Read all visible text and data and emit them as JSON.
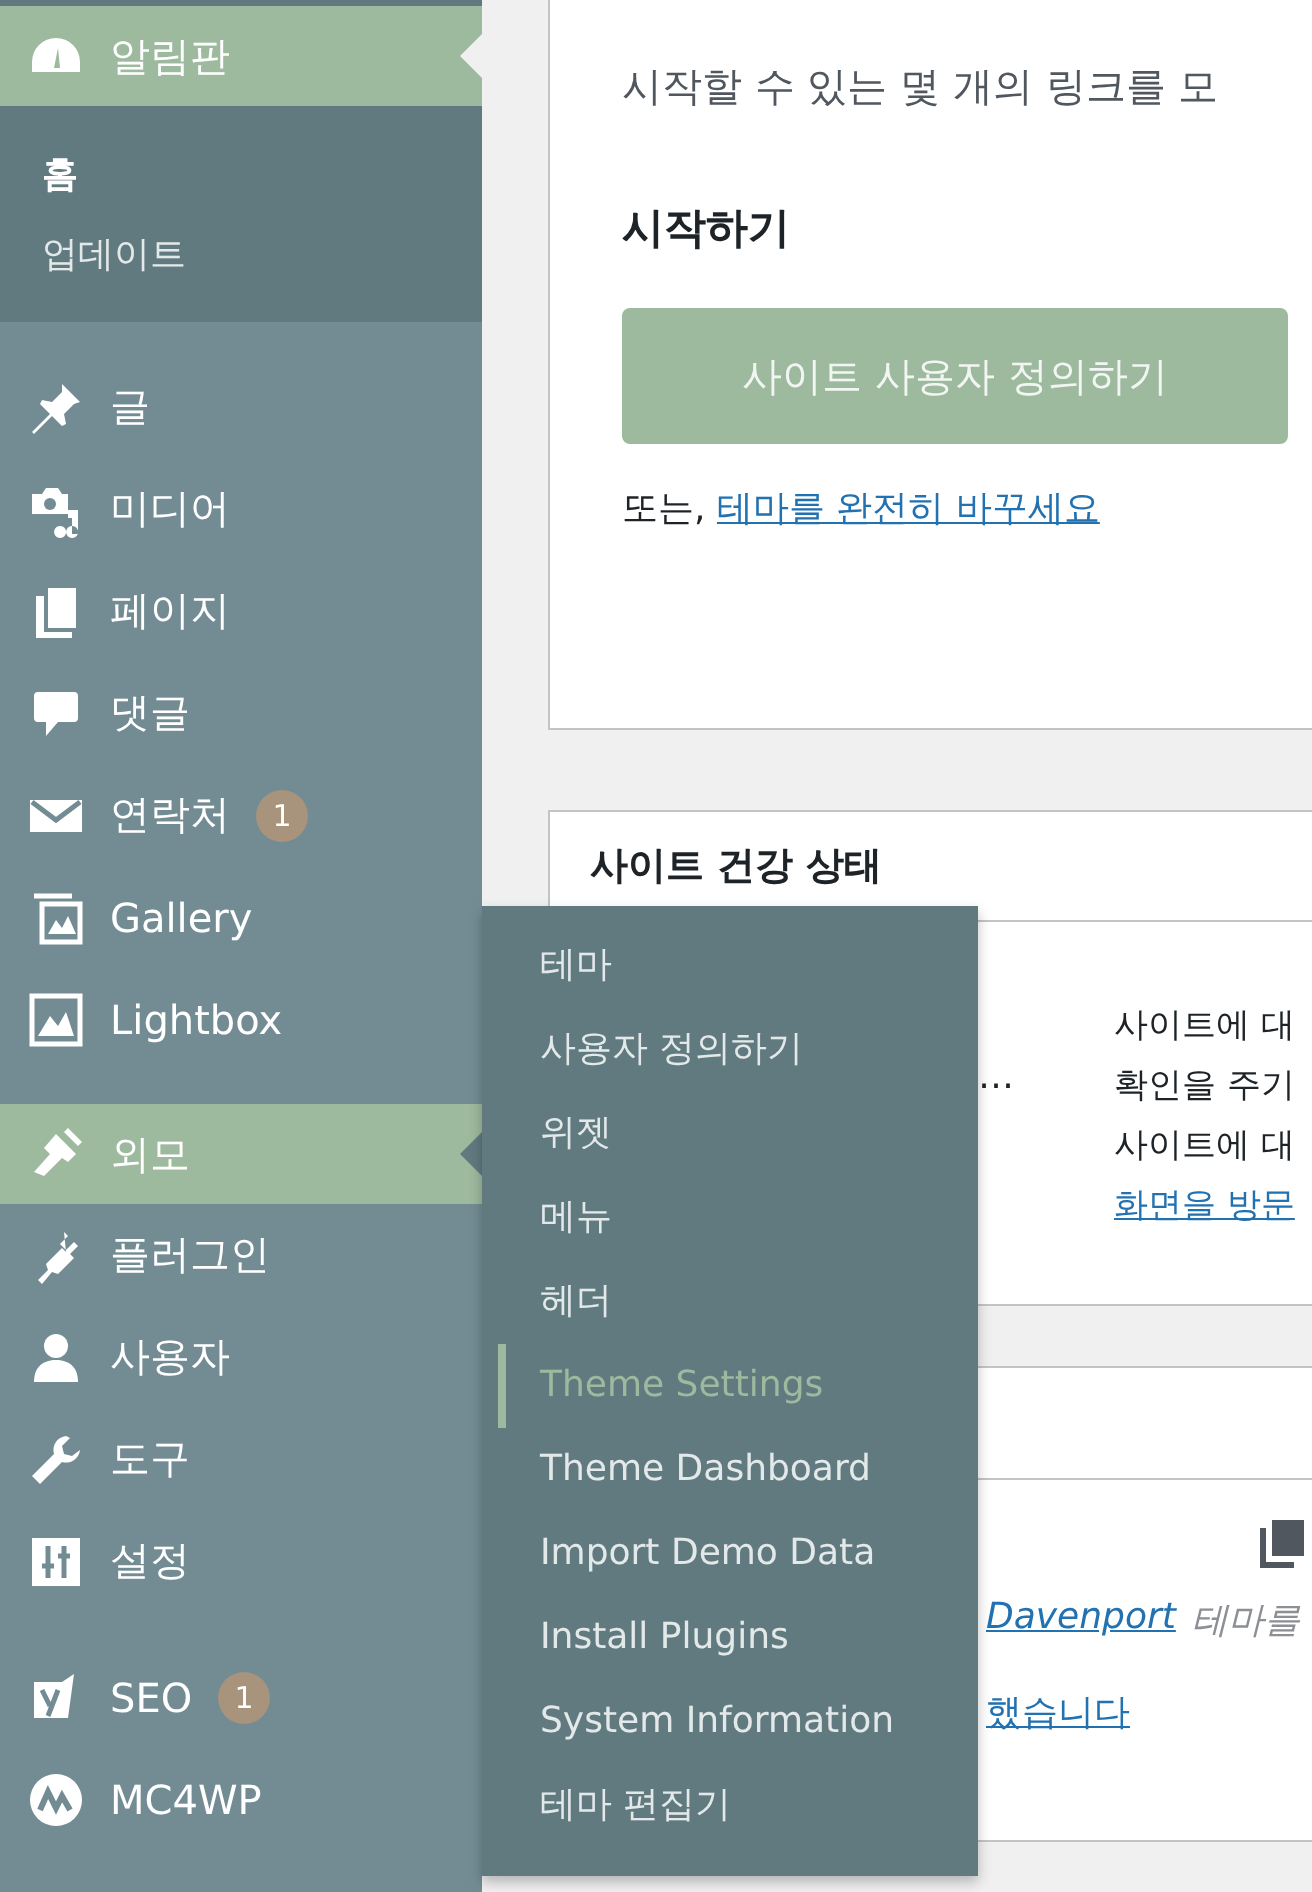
{
  "sidebar": {
    "groups": [
      [
        {
          "label": "알림판",
          "highlighted": true,
          "children": [
            {
              "label": "홈",
              "selected": true
            },
            {
              "label": "업데이트",
              "selected": false
            }
          ]
        }
      ],
      [
        {
          "label": "글",
          "highlighted": false
        },
        {
          "label": "미디어",
          "highlighted": false
        },
        {
          "label": "페이지",
          "highlighted": false
        },
        {
          "label": "댓글",
          "highlighted": false
        },
        {
          "label": "연락처",
          "highlighted": false,
          "badge": "1"
        },
        {
          "label": "Gallery",
          "highlighted": false
        },
        {
          "label": "Lightbox",
          "highlighted": false
        }
      ],
      [
        {
          "label": "외모",
          "highlighted": true,
          "flyout": [
            {
              "label": "테마",
              "selected": false
            },
            {
              "label": "사용자 정의하기",
              "selected": false
            },
            {
              "label": "위젯",
              "selected": false
            },
            {
              "label": "메뉴",
              "selected": false
            },
            {
              "label": "헤더",
              "selected": false
            },
            {
              "label": "Theme Settings",
              "selected": true
            },
            {
              "label": "Theme Dashboard",
              "selected": false
            },
            {
              "label": "Import Demo Data",
              "selected": false
            },
            {
              "label": "Install Plugins",
              "selected": false
            },
            {
              "label": "System Information",
              "selected": false
            },
            {
              "label": "테마 편집기",
              "selected": false
            }
          ]
        },
        {
          "label": "플러그인",
          "highlighted": false
        },
        {
          "label": "사용자",
          "highlighted": false
        },
        {
          "label": "도구",
          "highlighted": false
        },
        {
          "label": "설정",
          "highlighted": false
        }
      ],
      [
        {
          "label": "SEO",
          "highlighted": false,
          "badge": "1"
        },
        {
          "label": "MC4WP",
          "highlighted": false
        }
      ]
    ]
  },
  "welcome": {
    "subtitle": "시작할 수 있는 몇 개의 링크를 모",
    "section_title": "시작하기",
    "button": "사이트 사용자 정의하기",
    "alt_prefix": "또는,",
    "alt_link": "테마를 완전히 바꾸세요"
  },
  "site_health": {
    "title": "사이트 건강 상태",
    "status": "…",
    "lines": [
      "사이트에 대",
      "확인을 주기",
      "사이트에 대"
    ],
    "link": "화면을 방문"
  },
  "theme_card": {
    "theme_link": "Davenport",
    "theme_text": "테마를",
    "link": "했습니다"
  }
}
